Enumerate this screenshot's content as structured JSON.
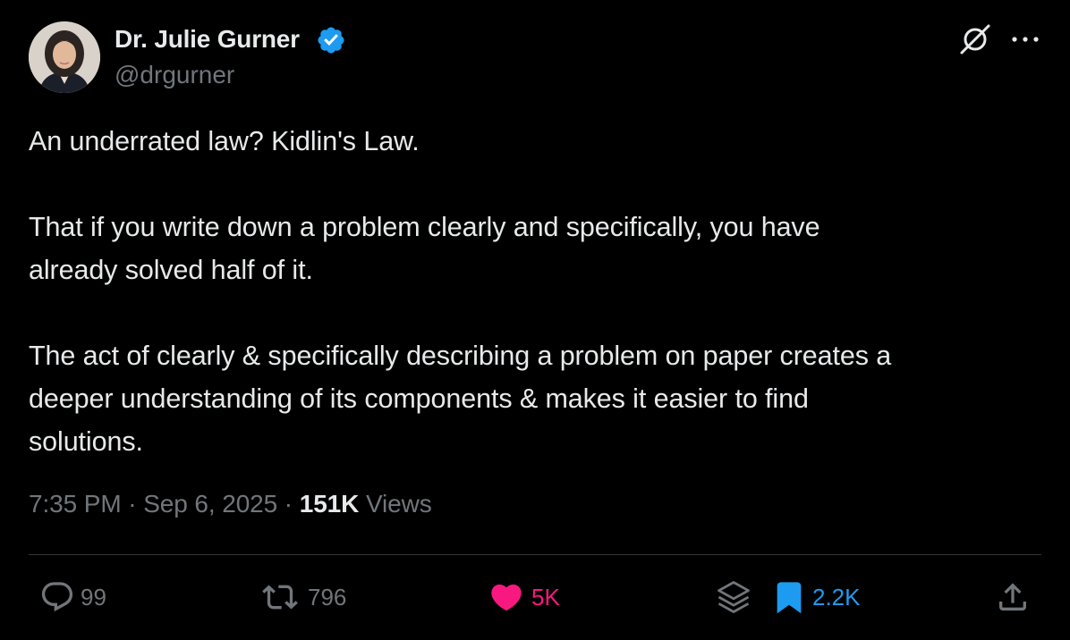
{
  "author": {
    "display_name": "Dr. Julie Gurner",
    "handle": "@drgurner",
    "verified": true
  },
  "tweet": {
    "paragraphs": [
      "An underrated law? Kidlin's Law.",
      "That if you write down a problem clearly and specifically, you have\nalready solved half of it.",
      "The act of clearly & specifically describing a problem on paper creates a\ndeeper understanding of its components & makes it easier to find\nsolutions."
    ],
    "time": "7:35 PM",
    "separator": "·",
    "date": "Sep 6, 2025",
    "views_count": "151K",
    "views_label": "Views"
  },
  "actions": {
    "replies": "99",
    "reposts": "796",
    "likes": "5K",
    "bookmarks": "2.2K"
  },
  "colors": {
    "background": "#000000",
    "primary_text": "#e7e9ea",
    "secondary_text": "#71767b",
    "verified_blue": "#1d9bf0",
    "like_pink": "#f91880",
    "bookmark_blue": "#1d9bf0",
    "divider": "#2f3336"
  },
  "icons": {
    "header": [
      "grok-icon",
      "more-icon"
    ],
    "action_bar": [
      "reply-icon",
      "repost-icon",
      "like-icon",
      "grok-stack-icon",
      "bookmark-icon",
      "share-icon"
    ]
  }
}
